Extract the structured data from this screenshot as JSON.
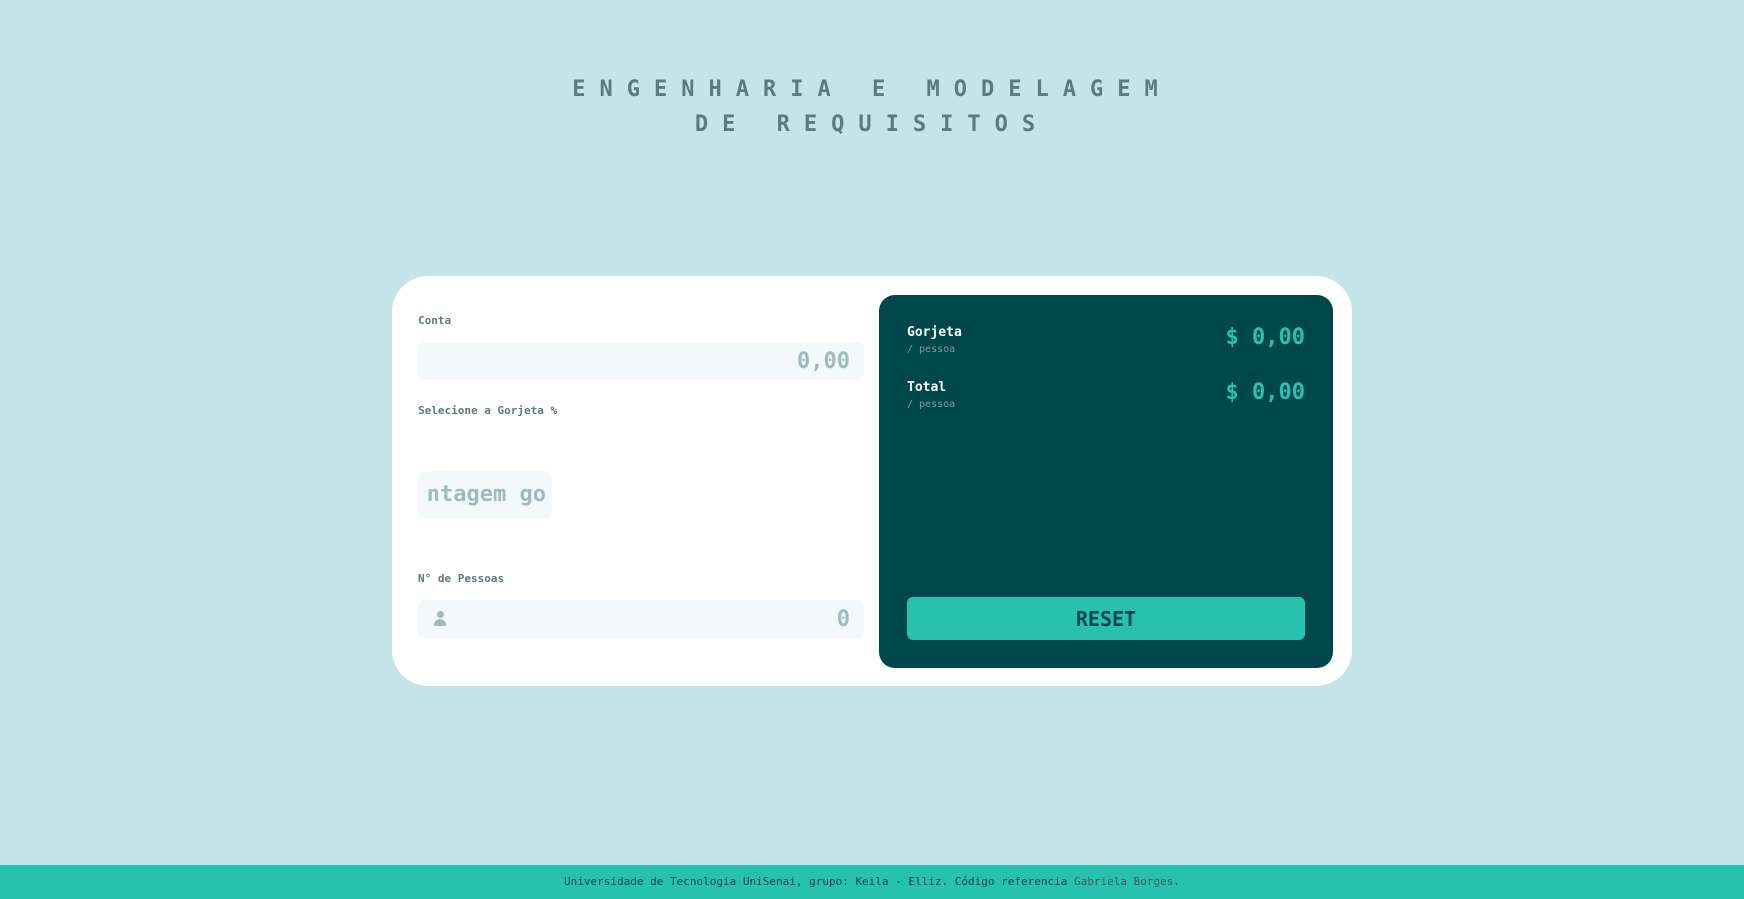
{
  "header": {
    "title_line1": "ENGENHARIA E MODELAGEM",
    "title_line2": "DE REQUISITOS"
  },
  "form": {
    "bill_label": "Conta",
    "bill_placeholder": "0,00",
    "tip_label": "Selecione a Gorjeta %",
    "custom_tip_placeholder": "Porcentagem gorjeta",
    "custom_tip_visible_text": "ntagem go",
    "people_label": "N° de Pessoas",
    "people_placeholder": "0",
    "people_icon": "person-icon"
  },
  "results": {
    "tip_label": "Gorjeta",
    "tip_sub": "/ pessoa",
    "tip_amount": "$ 0,00",
    "total_label": "Total",
    "total_sub": "/ pessoa",
    "total_amount": "$ 0,00",
    "reset_label": "RESET"
  },
  "footer": {
    "text": "Universidade de Tecnologia UniSenai, grupo: Keila - Elliz. Código referencia ",
    "link_text": "Gabriela Borges",
    "suffix": "."
  },
  "colors": {
    "background": "#c5e4e7",
    "card": "#ffffff",
    "dark": "#00474b",
    "accent": "#26c2ae",
    "muted": "#5e7a7d",
    "input_bg": "#f3f9fa"
  }
}
